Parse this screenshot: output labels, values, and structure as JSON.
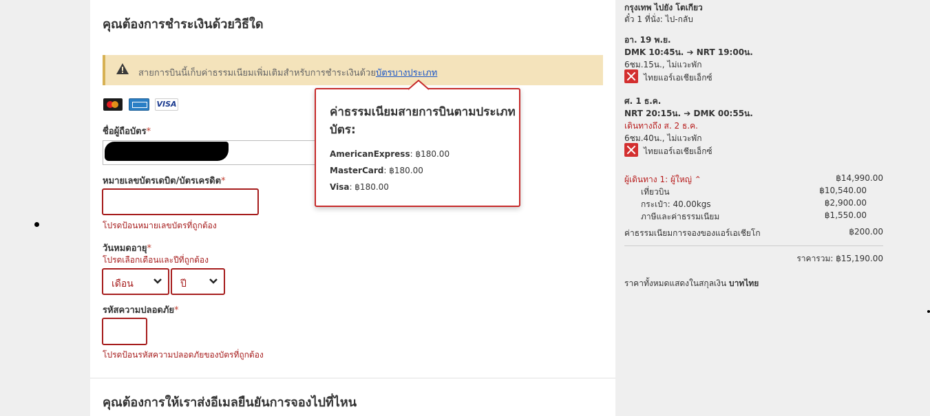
{
  "payment": {
    "title": "คุณต้องการชำระเงินด้วยวิธีใด",
    "warning_text": "สายการบินนี้เก็บค่าธรรมเนียมเพิ่มเติมสำหรับการชำระเงินด้วย",
    "warning_link": "บัตรบางประเภท",
    "card_brand_visa": "VISA",
    "name_label": "ชื่อผู้ถือบัตร",
    "number_label": "หมายเลขบัตรเดบิต/บัตรเครดิต",
    "number_error": "โปรดป้อนหมายเลขบัตรที่ถูกต้อง",
    "expiry_label": "วันหมดอายุ",
    "expiry_error": "โปรดเลือกเดือนและปีที่ถูกต้อง",
    "month_value": "เดือน",
    "year_value": "ปี",
    "cvv_label": "รหัสความปลอดภัย",
    "cvv_error": "โปรดป้อนรหัสความปลอดภัยของบัตรที่ถูกต้อง",
    "required_mark": "*"
  },
  "email_section": {
    "title": "คุณต้องการให้เราส่งอีเมลยืนยันการจองไปที่ไหน"
  },
  "tooltip": {
    "title": "ค่าธรรมเนียมสายการบินตามประเภทบัตร:",
    "rows": [
      {
        "brand": "AmericanExpress",
        "fee": "฿180.00"
      },
      {
        "brand": "MasterCard",
        "fee": "฿180.00"
      },
      {
        "brand": "Visa",
        "fee": "฿180.00"
      }
    ]
  },
  "summary": {
    "route": "กรุงเทพ ไปยัง โตเกียว",
    "ticket_info": "ตั๋ว 1 ที่นั่ง: ไป-กลับ",
    "outbound": {
      "date": "อา. 19 พ.ย.",
      "times": "DMK 10:45น. ➔ NRT 19:00น.",
      "duration": "6ชม.15น., ไม่แวะพัก",
      "airline": "ไทยแอร์เอเชียเอ็กซ์"
    },
    "return": {
      "date": "ศ. 1 ธ.ค.",
      "times": "NRT 20:15น. ➔ DMK 00:55น.",
      "arrival_note": "เดินทางถึง ส. 2 ธ.ค.",
      "duration": "6ชม.40น., ไม่แวะพัก",
      "airline": "ไทยแอร์เอเชียเอ็กซ์"
    },
    "passenger_label": "ผู้เดินทาง 1: ผู้ใหญ่ ⌃",
    "passenger_total": "฿14,990.00",
    "lines": [
      {
        "label": "เที่ยวบิน",
        "amount": "฿10,540.00"
      },
      {
        "label": "กระเป๋า: 40.00kgs",
        "amount": "฿2,900.00"
      },
      {
        "label": "ภาษีและค่าธรรมเนียม",
        "amount": "฿1,550.00"
      }
    ],
    "booking_fee_label": "ค่าธรรมเนียมการจองของแอร์เอเชียโก",
    "booking_fee": "฿200.00",
    "total_label": "ราคารวม:",
    "total": "฿15,190.00",
    "currency_note": "ราคาทั้งหมดแสดงในสกุลเงิน",
    "currency": "บาทไทย"
  },
  "colors": {
    "error": "#a61c1c",
    "warning_bg": "#f4e3bb",
    "link": "#1a55c7",
    "tooltip_border": "#c62828"
  }
}
